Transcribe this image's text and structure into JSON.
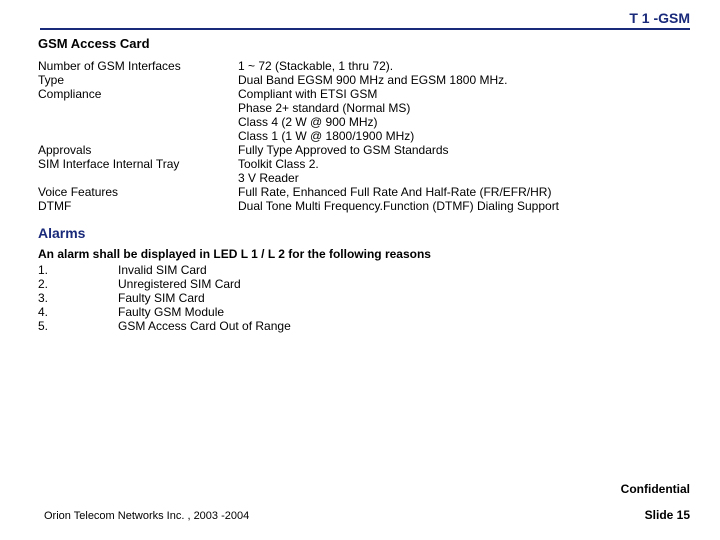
{
  "header": "T 1 -GSM",
  "section1_title": "GSM Access Card",
  "specs": [
    {
      "label": "Number of GSM Interfaces",
      "lines": [
        "1 ~ 72 (Stackable, 1 thru 72)."
      ]
    },
    {
      "label": "Type",
      "lines": [
        "Dual Band EGSM 900 MHz and EGSM 1800 MHz."
      ]
    },
    {
      "label": "Compliance",
      "lines": [
        "Compliant with ETSI GSM",
        "Phase 2+ standard (Normal MS)",
        "Class 4 (2 W @ 900 MHz)",
        "Class 1 (1 W @ 1800/1900 MHz)"
      ]
    },
    {
      "label": "Approvals",
      "lines": [
        "Fully Type Approved to GSM Standards"
      ]
    },
    {
      "label": "SIM Interface  Internal Tray",
      "lines": [
        "Toolkit Class 2.",
        "3 V Reader"
      ]
    },
    {
      "label": "Voice Features",
      "lines": [
        "Full Rate, Enhanced Full Rate And Half-Rate (FR/EFR/HR)"
      ]
    },
    {
      "label": "DTMF",
      "lines": [
        "Dual Tone Multi Frequency.Function (DTMF) Dialing Support"
      ]
    }
  ],
  "alarms_title": "Alarms",
  "alarms_intro": "An alarm shall be displayed in LED L 1  / L 2 for the following reasons",
  "alarms": [
    {
      "num": "1.",
      "text": "Invalid SIM Card"
    },
    {
      "num": "2.",
      "text": "Unregistered SIM Card"
    },
    {
      "num": "3.",
      "text": "Faulty SIM Card"
    },
    {
      "num": "4.",
      "text": "Faulty GSM Module"
    },
    {
      "num": "5.",
      "text": "GSM Access Card Out of Range"
    }
  ],
  "confidential": "Confidential",
  "footer_left": "Orion Telecom Networks Inc. , 2003 -2004",
  "footer_right": "Slide 15"
}
